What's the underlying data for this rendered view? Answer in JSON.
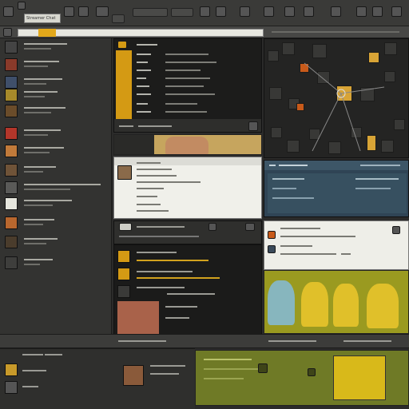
{
  "app": {
    "menu_title": "Streamer Chat"
  },
  "colors": {
    "accent": "#d49a14",
    "background": "#2b2b2a",
    "panel_dark": "#1c1c1b",
    "panel_blue": "#2f4455",
    "olive": "#6f7a26"
  },
  "icons": [
    "back-arrow-icon",
    "forward-arrow-icon",
    "refresh-icon",
    "home-icon",
    "settings-icon",
    "menu-icon",
    "close-icon"
  ]
}
